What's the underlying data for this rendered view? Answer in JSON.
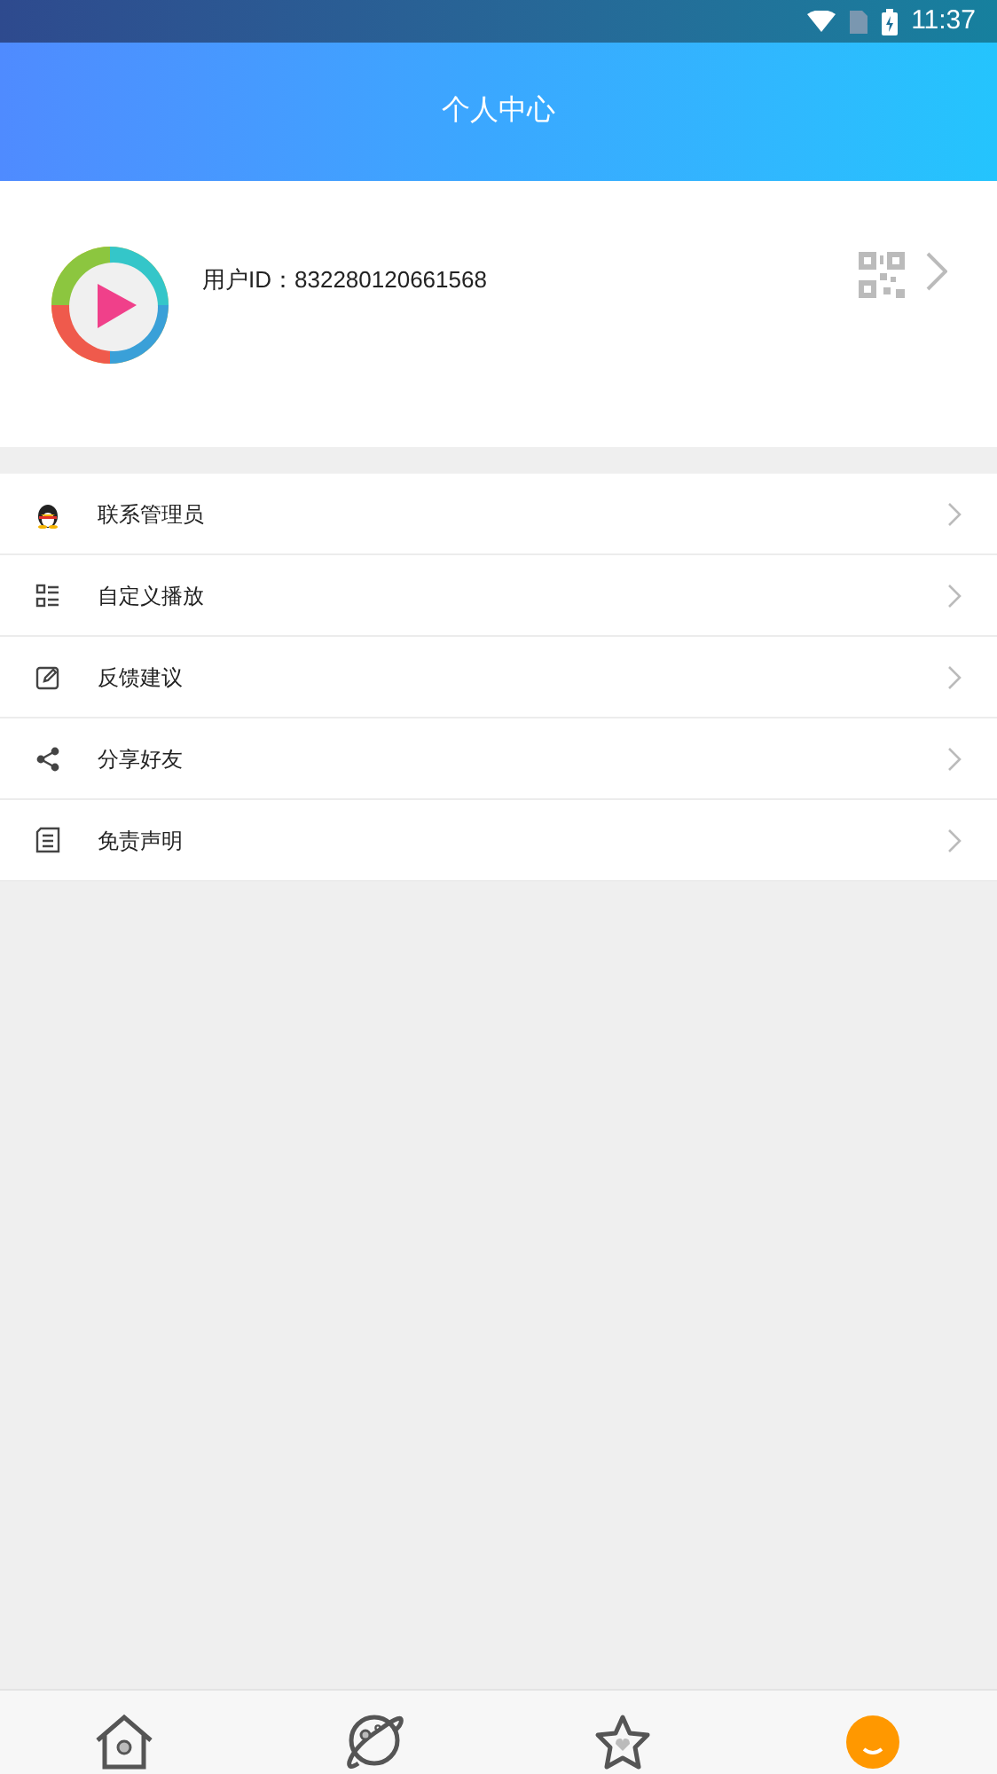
{
  "status_bar": {
    "time": "11:37"
  },
  "header": {
    "title": "个人中心"
  },
  "profile": {
    "user_id": "用户ID：832280120661568"
  },
  "menu": [
    {
      "kind": "qq",
      "label": "联系管理员"
    },
    {
      "kind": "list",
      "label": "自定义播放"
    },
    {
      "kind": "edit",
      "label": "反馈建议"
    },
    {
      "kind": "share",
      "label": "分享好友"
    },
    {
      "kind": "doc",
      "label": "免责声明"
    }
  ],
  "tab_bar": [
    {
      "kind": "home",
      "selected": false
    },
    {
      "kind": "planet",
      "selected": false
    },
    {
      "kind": "star",
      "selected": false
    },
    {
      "kind": "me",
      "selected": true
    }
  ]
}
